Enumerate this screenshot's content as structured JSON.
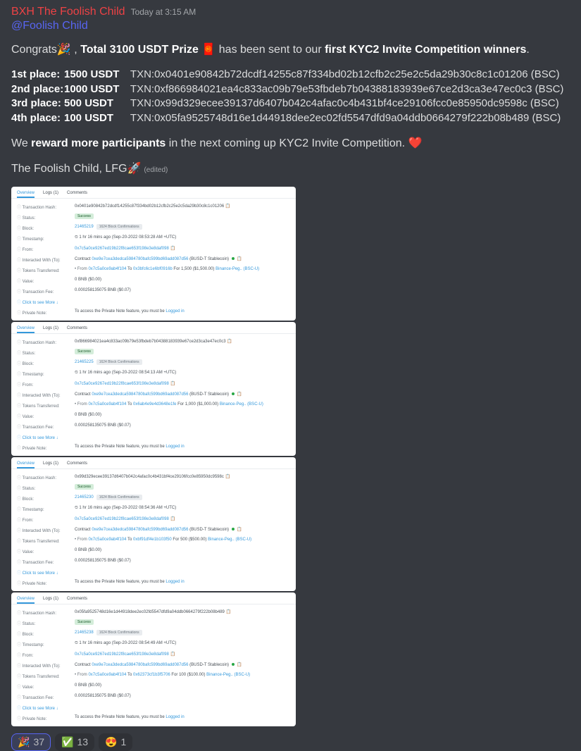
{
  "header": {
    "author": "BXH The Foolish Child",
    "timestamp": "Today at 3:15 AM"
  },
  "mention": "@Foolish Child",
  "congrats": {
    "pre": "Congrats🎉 , ",
    "bold1": "Total 3100 USDT Prize",
    "mid": " 🧧 has been sent to our ",
    "bold2": "first KYC2 Invite Competition winners",
    "end": "."
  },
  "places": [
    {
      "lbl": "1st place:",
      "amt": "1500 USDT",
      "txn": "TXN:0x0401e90842b72dcdf14255c87f334bd02b12cfb2c25e2c5da29b30c8c1c01206 (BSC)"
    },
    {
      "lbl": "2nd place:",
      "amt": "1000 USDT",
      "txn": "TXN:0xf866984021ea4c833ac09b79e53fbdeb7b04388183939e67ce2d3ca3e47ec0c3 (BSC)"
    },
    {
      "lbl": "3rd place:",
      "amt": "500 USDT",
      "txn": "TXN:0x99d329ecee39137d6407b042c4afac0c4b431bf4ce29106fcc0e85950dc9598c (BSC)"
    },
    {
      "lbl": "4th place:",
      "amt": "100 USDT",
      "txn": "TXN:0x05fa9525748d16e1d44918dee2ec02fd5547dfd9a04ddb0664279f222b08b489 (BSC)"
    }
  ],
  "reward": {
    "pre": " We ",
    "bold": "reward more participants",
    "post": " in the next coming up KYC2 Invite Competition. ❤️"
  },
  "signoff": {
    "text": "The Foolish Child, LFG🚀",
    "edited": "(edited)"
  },
  "tabs": {
    "overview": "Overview",
    "logs": "Logs (1)",
    "comments": "Comments"
  },
  "fields": {
    "hash": "Transaction Hash:",
    "status": "Status:",
    "block": "Block:",
    "time": "Timestamp:",
    "from": "From:",
    "inter": "Interacted With (To):",
    "tok": "Tokens Transferred:",
    "val": "Value:",
    "fee": "Transaction Fee:",
    "more": "Click to see More",
    "note": "Private Note:"
  },
  "common": {
    "success": "Success",
    "note": "To access the Private Note feature, you must be Logged in",
    "logged": "Logged in",
    "conf": "1624 Block Confirmations",
    "valzero": "0 BNB   ($0.00)",
    "fee": "0.000258135075 BNB ($0.07)",
    "from_addr": "0x7c5a0ce9267ed19b22f8cae653f198e3e8daf098",
    "contract_pre": "Contract ",
    "contract_addr": "0xe9e7cea3dedca5984780bafc599bd69add087d56",
    "contract_post": " (BUSD-T Stablecoin)",
    "tk_from": "• From ",
    "tk_to": " To ",
    "tk_for_pre": " For ",
    "tk_post": " Binance-Peg..  (BSC-U)",
    "from_short": "0x7c5a0ce9ab4f104"
  },
  "scans": [
    {
      "hash": "0x0401e90842b72dcdf14255c87f334bd02b12cfb2c25e2c5da29b30c8c1c01206",
      "block": "21465219",
      "time": "⏲ 1 hr 16 mins ago (Sep-20-2022 08:53:28 AM +UTC)",
      "to": "0x3bfc6c1e6bf0916b",
      "for": "1,500 ($1,500.00)"
    },
    {
      "hash": "0xf866984021ea4c833ac09b79e53fbdeb7b04388183939e67ce2d3ca3e47ec0c3",
      "block": "21465225",
      "time": "⏲ 1 hr 16 mins ago (Sep-20-2022 08:54:13 AM +UTC)",
      "to": "0x6ab4e9e4d3648e1fe",
      "for": "1,000 ($1,000.00)"
    },
    {
      "hash": "0x99d329ecee39137d6407b042c4afac0c4b431bf4ce29106fcc0e85950dc9598c",
      "block": "21465230",
      "time": "⏲ 1 hr 16 mins ago (Sep-20-2022 08:54:36 AM +UTC)",
      "to": "0xbf91df4e1b103f50",
      "for": "500 ($500.00)"
    },
    {
      "hash": "0x05fa9525748d16e1d44918dee2ec02fd5547dfd9a04ddb0664279f222b08b489",
      "block": "21465238",
      "time": "⏲ 1 hr 16 mins ago (Sep-20-2022 08:54:49 AM +UTC)",
      "to": "0x62373cf1b3f5706",
      "for": "100 ($100.00)"
    }
  ],
  "reactions": [
    {
      "emoji": "🎉",
      "count": "37",
      "self": true
    },
    {
      "emoji": "✅",
      "count": "13",
      "self": false
    },
    {
      "emoji": "😍",
      "count": "1",
      "self": false
    }
  ]
}
